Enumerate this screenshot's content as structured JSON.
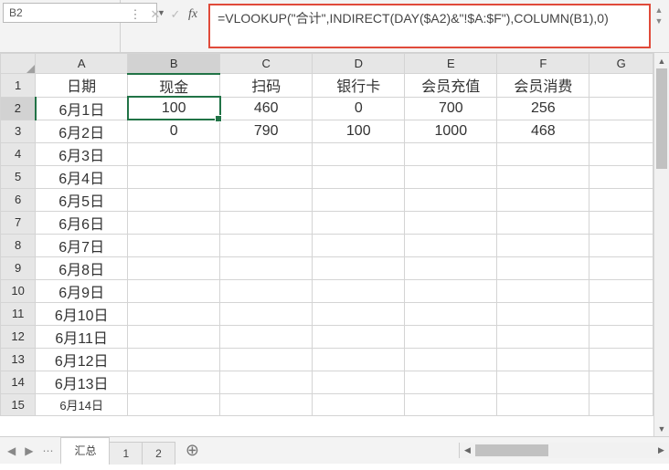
{
  "nameBox": {
    "value": "B2"
  },
  "formulaBar": {
    "fxLabel": "fx",
    "formula": "=VLOOKUP(\"合计\",INDIRECT(DAY($A2)&\"!$A:$F\"),COLUMN(B1),0)"
  },
  "columns": [
    "A",
    "B",
    "C",
    "D",
    "E",
    "F",
    "G"
  ],
  "rowNumbers": [
    "1",
    "2",
    "3",
    "4",
    "5",
    "6",
    "7",
    "8",
    "9",
    "10",
    "11",
    "12",
    "13",
    "14",
    "15"
  ],
  "headers": {
    "A": "日期",
    "B": "现金",
    "C": "扫码",
    "D": "银行卡",
    "E": "会员充值",
    "F": "会员消费"
  },
  "rows": [
    {
      "A": "6月1日",
      "B": "100",
      "C": "460",
      "D": "0",
      "E": "700",
      "F": "256"
    },
    {
      "A": "6月2日",
      "B": "0",
      "C": "790",
      "D": "100",
      "E": "1000",
      "F": "468"
    },
    {
      "A": "6月3日"
    },
    {
      "A": "6月4日"
    },
    {
      "A": "6月5日"
    },
    {
      "A": "6月6日"
    },
    {
      "A": "6月7日"
    },
    {
      "A": "6月8日"
    },
    {
      "A": "6月9日"
    },
    {
      "A": "6月10日"
    },
    {
      "A": "6月11日"
    },
    {
      "A": "6月12日"
    },
    {
      "A": "6月13日"
    },
    {
      "A": "6月14日"
    }
  ],
  "selected": {
    "col": "B",
    "row": 2
  },
  "sheetTabs": {
    "tabs": [
      "汇总",
      "1",
      "2"
    ],
    "activeIndex": 0,
    "navPrev": "◀",
    "navNext": "▶",
    "navMore": "⋯",
    "addLabel": "⊕"
  }
}
